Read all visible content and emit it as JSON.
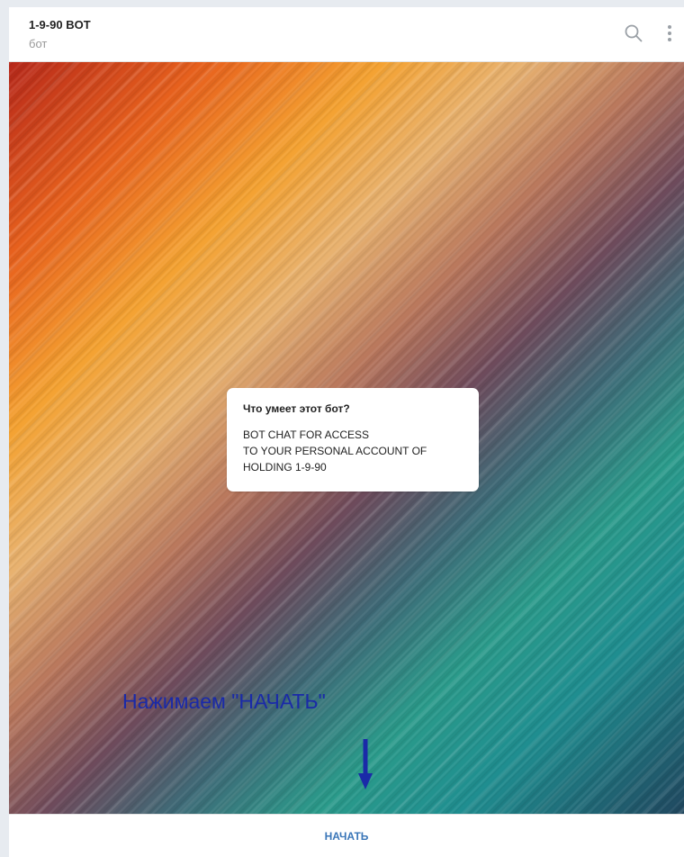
{
  "header": {
    "title": "1-9-90 BOT",
    "subtitle": "бот",
    "icons": [
      "search-icon",
      "more-vertical-icon"
    ]
  },
  "info_card": {
    "title": "Что умеет этот бот?",
    "lines": [
      "BOT CHAT FOR ACCESS",
      "TO YOUR PERSONAL ACCOUNT OF",
      "HOLDING 1-9-90"
    ]
  },
  "annotation": {
    "text": "Нажимаем \"НАЧАТЬ\"",
    "color": "#1a2aa8",
    "icon": "arrow-down-icon"
  },
  "footer": {
    "start_label": "НАЧАТЬ",
    "accent": "#3a76b8"
  }
}
